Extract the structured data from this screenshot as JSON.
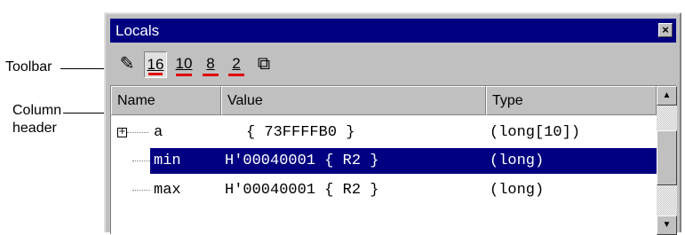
{
  "annotations": {
    "toolbar": "Toolbar",
    "column_header_line1": "Column",
    "column_header_line2": "header"
  },
  "window": {
    "title": "Locals",
    "close_glyph": "×"
  },
  "toolbar": {
    "buttons": [
      {
        "icon": "pencil-icon",
        "glyph": "✎"
      },
      {
        "label": "16",
        "pressed": true
      },
      {
        "label": "10"
      },
      {
        "label": "8"
      },
      {
        "label": "2"
      },
      {
        "icon": "copy-window-icon",
        "glyph": "⧉"
      }
    ]
  },
  "columns": [
    "Name",
    "Value",
    "Type"
  ],
  "rows": [
    {
      "name": "a",
      "value": "{ 73FFFFB0 }",
      "type": "(long[10])",
      "expandable": true,
      "expand_glyph": "+"
    },
    {
      "name": "min",
      "value": "H'00040001 { R2 }",
      "type": "(long)",
      "selected": true
    },
    {
      "name": "max",
      "value": "H'00040001 { R2 }",
      "type": "(long)"
    }
  ],
  "scrollbar": {
    "up_glyph": "▲",
    "down_glyph": "▼"
  },
  "colors": {
    "titlebar": "#000080",
    "selection": "#000080",
    "radix_underline": "#e00000"
  }
}
